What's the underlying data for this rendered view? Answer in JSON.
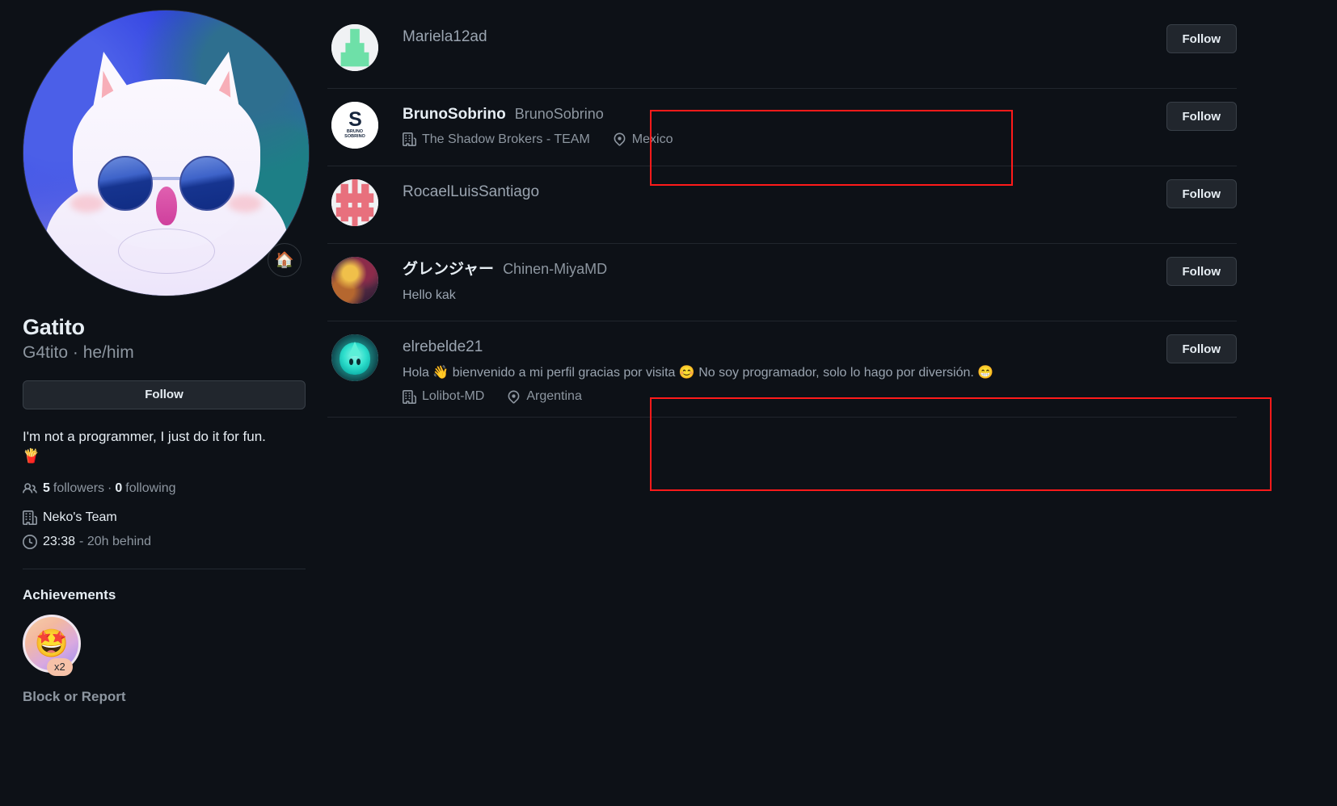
{
  "profile": {
    "avatar_alt": "white-cat-with-blue-sunglasses",
    "status_emoji": "🏠",
    "display_name": "Gatito",
    "login": "G4tito",
    "pronouns": "he/him",
    "login_line": "G4tito · he/him",
    "follow_label": "Follow",
    "bio": "I'm not a programmer, I just do it for fun.",
    "bio_emoji": "🍟",
    "followers_count": "5",
    "followers_label": "followers",
    "following_count": "0",
    "following_label": "following",
    "separator": "·",
    "organization": "Neko's Team",
    "local_time": "23:38",
    "time_offset": "- 20h behind",
    "achievements_title": "Achievements",
    "achievement_emoji": "🤩",
    "achievement_count": "x2",
    "block_or_report": "Block or Report",
    "icons": {
      "people": "people-icon",
      "organization": "organization-icon",
      "clock": "clock-icon",
      "status": "house-icon"
    }
  },
  "followers": [
    {
      "display_name": "",
      "login": "Mariela12ad",
      "bio": "",
      "organization": "",
      "location": "",
      "follow_label": "Follow",
      "avatar_type": "identicon-green",
      "highlighted": false
    },
    {
      "display_name": "BrunoSobrino",
      "login": "BrunoSobrino",
      "bio": "",
      "organization": "The Shadow Brokers - TEAM",
      "location": "Mexico",
      "follow_label": "Follow",
      "avatar_type": "logo-bruno",
      "avatar_mark": "S",
      "avatar_sub_line1": "BRUNO",
      "avatar_sub_line2": "SOBRINO",
      "highlighted": true
    },
    {
      "display_name": "",
      "login": "RocaelLuisSantiago",
      "bio": "",
      "organization": "",
      "location": "",
      "follow_label": "Follow",
      "avatar_type": "identicon-red",
      "highlighted": false
    },
    {
      "display_name": "グレンジャー",
      "login": "Chinen-MiyaMD",
      "bio": "Hello kak",
      "organization": "",
      "location": "",
      "follow_label": "Follow",
      "avatar_type": "photo-anime",
      "highlighted": false
    },
    {
      "display_name": "",
      "login": "elrebelde21",
      "bio": "Hola 👋 bienvenido a mi perfil gracias por visita 😊 No soy programador, solo lo hago por diversión. 😁",
      "organization": "Lolibot-MD",
      "location": "Argentina",
      "follow_label": "Follow",
      "avatar_type": "photo-ghost",
      "highlighted": true
    }
  ],
  "colors": {
    "background": "#0d1117",
    "text_primary": "#e6edf3",
    "text_muted": "#8d96a0",
    "button_bg": "#21262d",
    "button_border": "#383f47",
    "divider": "#21262d",
    "highlight": "#ff1a1a",
    "identicon_green": "#6ee0a8",
    "identicon_red": "#e8707d"
  }
}
